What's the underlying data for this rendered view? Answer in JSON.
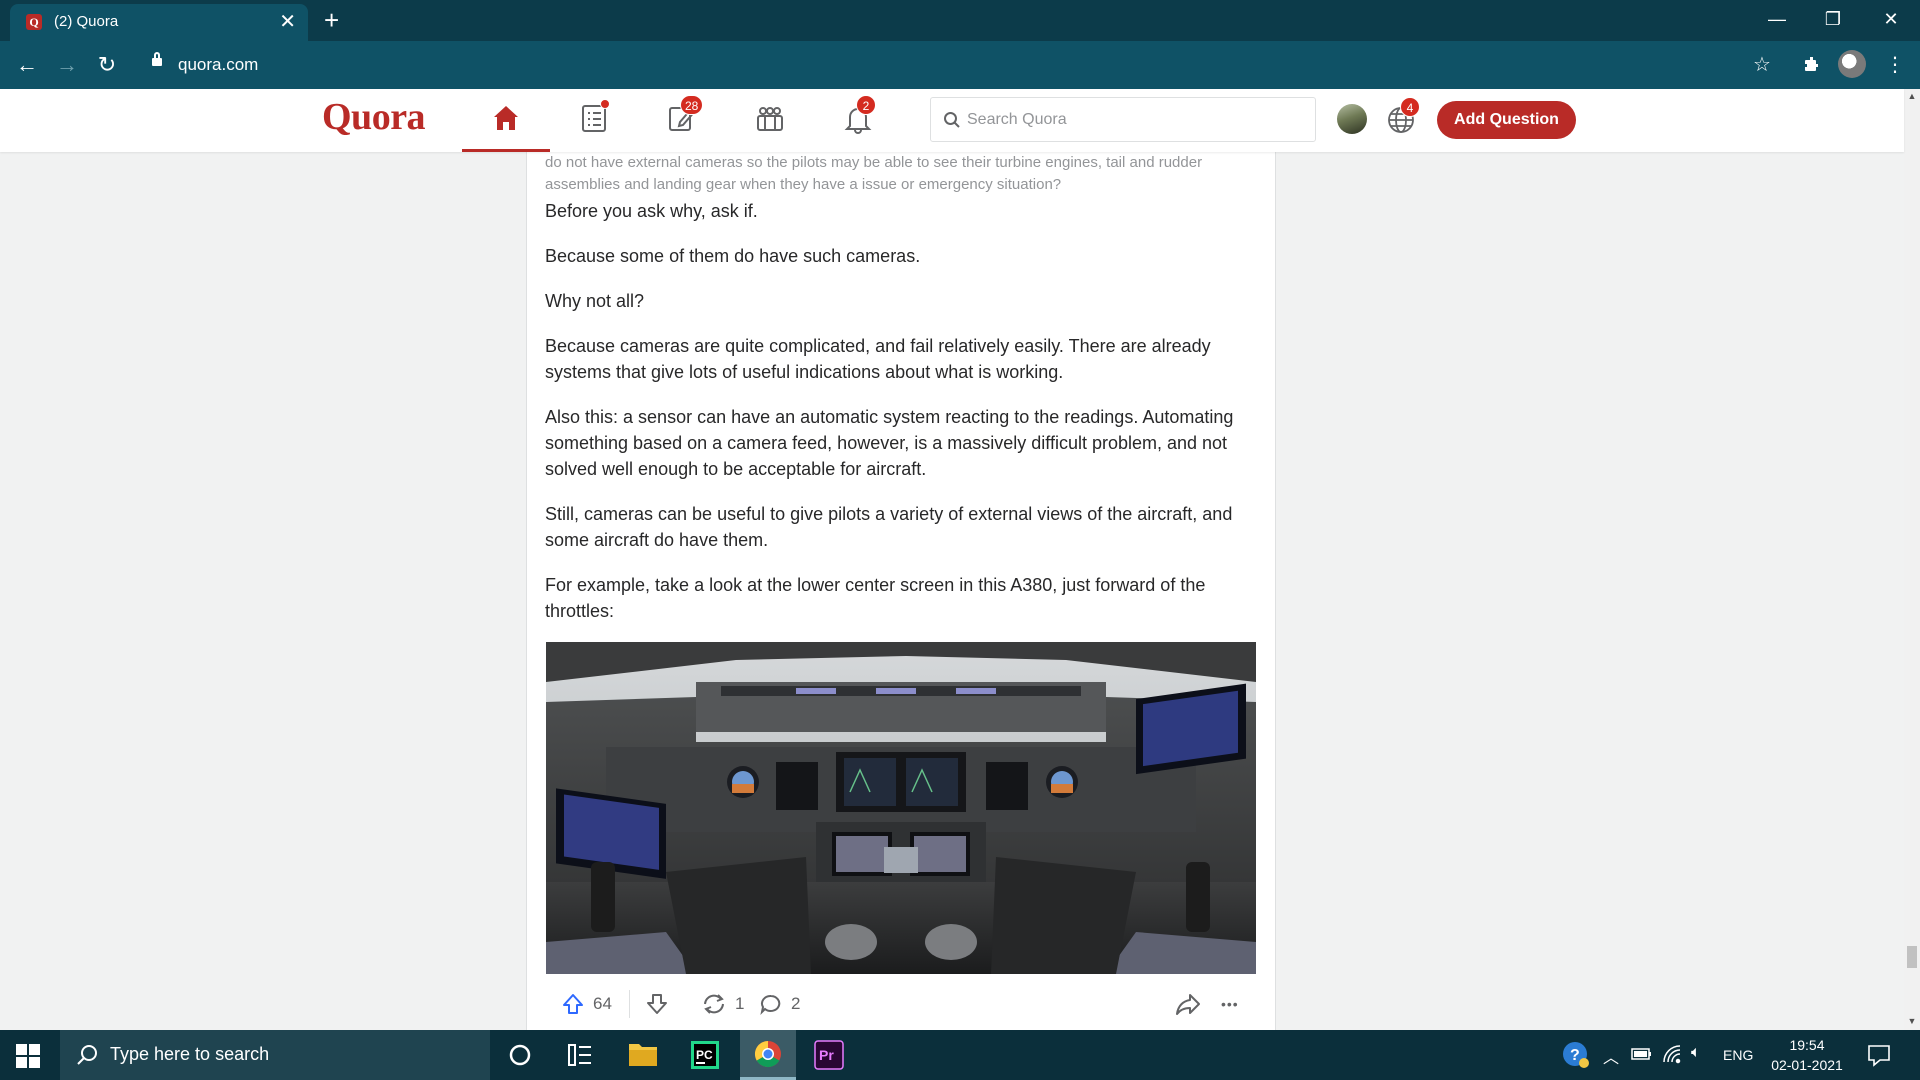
{
  "browser": {
    "tab_title": "(2) Quora",
    "tab_favicon_letter": "Q",
    "tab_close": "✕",
    "new_tab": "+",
    "url": "quora.com",
    "window_controls": {
      "minimize": "—",
      "restore": "❐",
      "close": "✕"
    }
  },
  "quora": {
    "logo": "Quora",
    "badges": {
      "spaces": "28",
      "notifications": "2",
      "languages": "4"
    },
    "search_placeholder": "Search Quora",
    "add_question": "Add Question"
  },
  "post": {
    "question_text": "do not have external cameras so the pilots may be able to see their turbine engines, tail and rudder assemblies and landing gear when they have a issue or emergency situation?",
    "paragraphs": [
      "Before you ask why, ask if.",
      "Because some of them do have such cameras.",
      "Why not all?",
      "Because cameras are quite complicated, and fail relatively easily. There are already systems that give lots of useful indications about what is working.",
      "Also this: a sensor can have an automatic system reacting to the readings. Automating something based on a camera feed, however, is a massively difficult problem, and not solved well enough to be acceptable for aircraft.",
      "Still, cameras can be useful to give pilots a variety of external views of the aircraft, and some aircraft do have them.",
      "For example, take a look at the lower center screen in this A380, just forward of the throttles:"
    ],
    "upvotes": "64",
    "shares": "1",
    "comments": "2",
    "more": "•••"
  },
  "taskbar": {
    "search_placeholder": "Type here to search",
    "language": "ENG",
    "time": "19:54",
    "date": "02-01-2021",
    "pycharm_label": "PC",
    "premiere_label": "Pr"
  }
}
